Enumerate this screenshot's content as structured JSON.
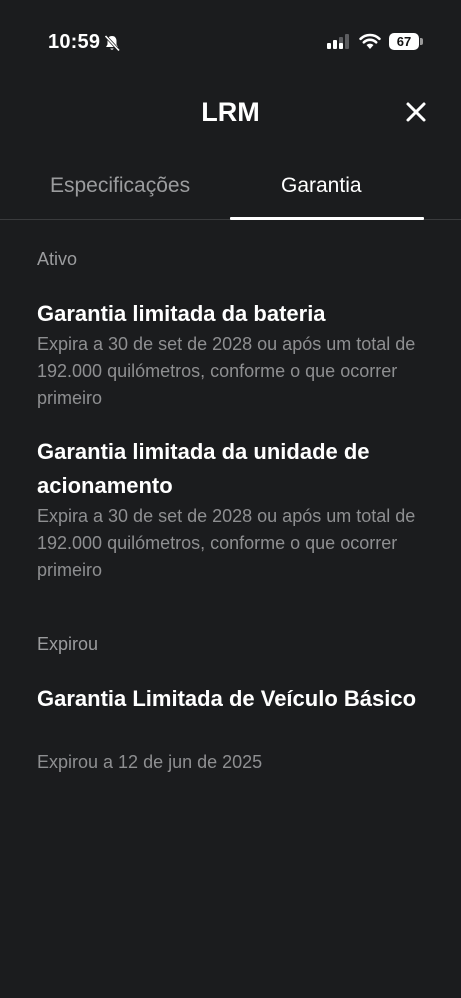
{
  "status_bar": {
    "time": "10:59",
    "battery_level": "67",
    "icons": [
      "bell-slash-icon",
      "cellular-signal-icon",
      "wifi-icon",
      "battery-icon"
    ]
  },
  "header": {
    "title": "LRM",
    "close_icon": "close-icon"
  },
  "tabs": [
    {
      "label": "Especificações",
      "active": false
    },
    {
      "label": "Garantia",
      "active": true
    }
  ],
  "sections": [
    {
      "label": "Ativo",
      "items": [
        {
          "title": "Garantia limitada da bateria",
          "description": "Expira a 30 de set de 2028 ou após um total de 192.000 quilómetros, conforme o que ocorrer primeiro"
        },
        {
          "title": "Garantia limitada da unidade de acionamento",
          "description": "Expira a 30 de set de 2028 ou após um total de 192.000 quilómetros, conforme o que ocorrer primeiro"
        }
      ]
    },
    {
      "label": "Expirou",
      "items": [
        {
          "title": "Garantia Limitada de Veículo Básico",
          "description": "Expirou a 12 de jun de 2025"
        }
      ]
    }
  ],
  "colors": {
    "background": "#1b1c1e",
    "text_primary": "#ffffff",
    "text_secondary": "#8e8f91",
    "divider": "#3a3b3d"
  }
}
